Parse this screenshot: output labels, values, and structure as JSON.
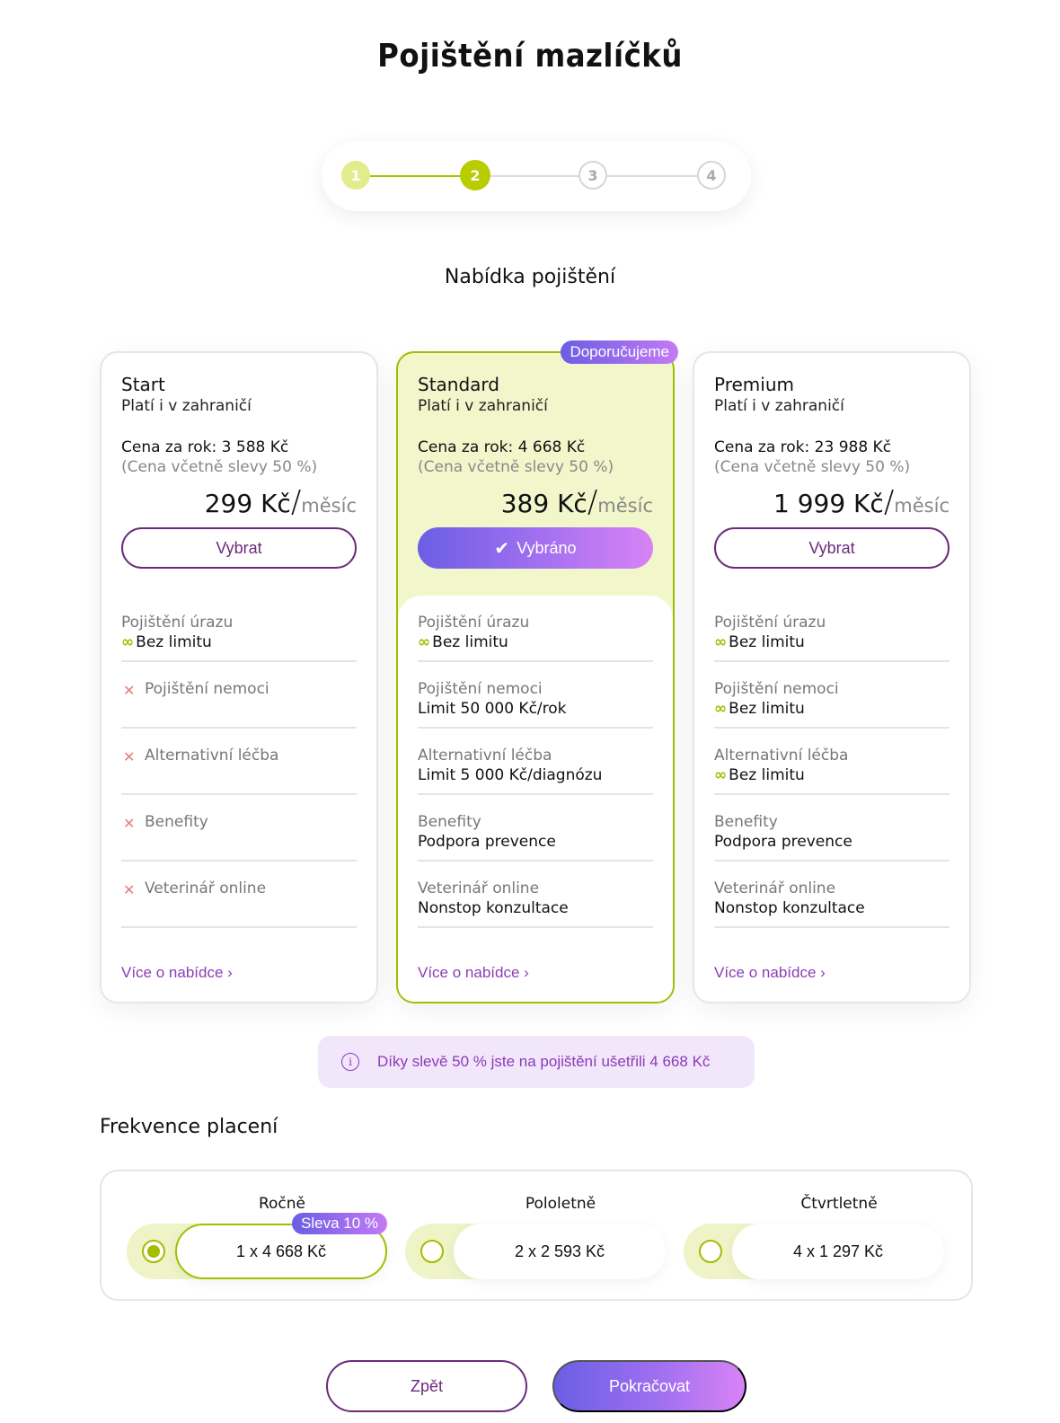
{
  "page": {
    "title": "Pojištění mazlíčků"
  },
  "stepper": {
    "steps": [
      "1",
      "2",
      "3",
      "4"
    ],
    "current": 2
  },
  "offer": {
    "title": "Nabídka pojištění"
  },
  "plans": [
    {
      "name": "Start",
      "subtitle": "Platí i v zahraničí",
      "year_price": "Cena za rok: 3 588 Kč",
      "discount_note": "(Cena včetně slevy 50 %)",
      "monthly_price": "299 Kč",
      "monthly_unit": "měsíc",
      "button": "Vybrat",
      "features": [
        {
          "label": "Pojištění úrazu",
          "value": "Bez limitu",
          "included": true,
          "unlimited": true
        },
        {
          "label": "Pojištění nemoci",
          "value": "",
          "included": false
        },
        {
          "label": "Alternativní léčba",
          "value": "",
          "included": false
        },
        {
          "label": "Benefity",
          "value": "",
          "included": false
        },
        {
          "label": "Veterinář online",
          "value": "",
          "included": false
        }
      ],
      "more": "Více o nabídce ›"
    },
    {
      "name": "Standard",
      "subtitle": "Platí i v zahraničí",
      "badge": "Doporučujeme",
      "year_price": "Cena za rok: 4 668 Kč",
      "discount_note": "(Cena včetně slevy 50 %)",
      "monthly_price": "389 Kč",
      "monthly_unit": "měsíc",
      "button": "Vybráno",
      "selected": true,
      "features": [
        {
          "label": "Pojištění úrazu",
          "value": "Bez limitu",
          "included": true,
          "unlimited": true
        },
        {
          "label": "Pojištění nemoci",
          "value": "Limit 50 000 Kč/rok",
          "included": true
        },
        {
          "label": "Alternativní léčba",
          "value": "Limit 5 000 Kč/diagnózu",
          "included": true
        },
        {
          "label": "Benefity",
          "value": "Podpora prevence",
          "included": true
        },
        {
          "label": "Veterinář online",
          "value": "Nonstop konzultace",
          "included": true
        }
      ],
      "more": "Více o nabídce ›"
    },
    {
      "name": "Premium",
      "subtitle": "Platí i v zahraničí",
      "year_price": "Cena za rok: 23 988 Kč",
      "discount_note": "(Cena včetně slevy 50 %)",
      "monthly_price": "1 999 Kč",
      "monthly_unit": "měsíc",
      "button": "Vybrat",
      "features": [
        {
          "label": "Pojištění úrazu",
          "value": "Bez limitu",
          "included": true,
          "unlimited": true
        },
        {
          "label": "Pojištění nemoci",
          "value": "Bez limitu",
          "included": true,
          "unlimited": true
        },
        {
          "label": "Alternativní léčba",
          "value": "Bez limitu",
          "included": true,
          "unlimited": true
        },
        {
          "label": "Benefity",
          "value": "Podpora prevence",
          "included": true
        },
        {
          "label": "Veterinář online",
          "value": "Nonstop konzultace",
          "included": true
        }
      ],
      "more": "Více o nabídce ›"
    }
  ],
  "info": {
    "text": "Díky slevě 50 % jste na pojištění ušetřili 4 668 Kč"
  },
  "frequency": {
    "title": "Frekvence placení",
    "options": [
      {
        "label": "Ročně",
        "price": "1 x 4 668 Kč",
        "badge": "Sleva 10 %",
        "selected": true
      },
      {
        "label": "Pololetně",
        "price": "2 x 2 593 Kč",
        "selected": false
      },
      {
        "label": "Čtvrtletně",
        "price": "4 x 1 297 Kč",
        "selected": false
      }
    ]
  },
  "actions": {
    "back": "Zpět",
    "next": "Pokračovat"
  },
  "icons": {
    "unlimited": "infinity-icon",
    "excluded": "x-icon",
    "info": "info-icon",
    "check": "check-icon"
  },
  "colors": {
    "accent_lime": "#a4bd00",
    "accent_purple": "#6b2a7d",
    "gradient_start": "#6b5ee4",
    "gradient_end": "#d883f5"
  }
}
